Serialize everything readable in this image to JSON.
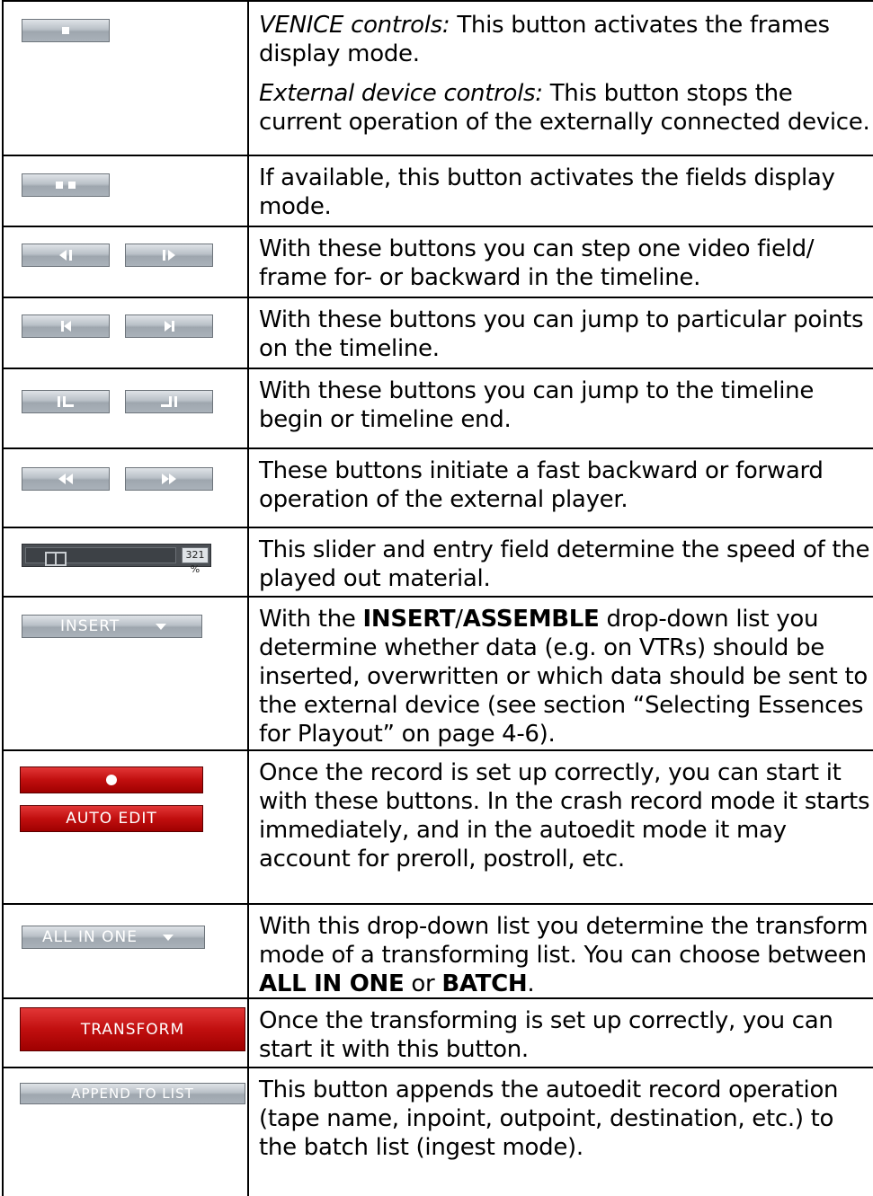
{
  "colors": {
    "grey_button": "#b9c0c7",
    "red_button": "#c10f0f",
    "rule": "#000000"
  },
  "rows": [
    {
      "icons": [
        "stop-frames-icon"
      ],
      "paragraphs": [
        {
          "italic": "VENICE controls:",
          "text": " This button activates the frames display mode."
        },
        {
          "italic": "External device controls:",
          "text": " This button stops the current operation of the externally connected device."
        }
      ]
    },
    {
      "icons": [
        "fields-icon"
      ],
      "paragraphs": [
        {
          "text": "If available, this button activates the fields display mode."
        }
      ]
    },
    {
      "icons": [
        "step-back-icon",
        "step-forward-icon"
      ],
      "paragraphs": [
        {
          "text": "With these buttons you can step one video field/ frame for- or backward in the timeline."
        }
      ]
    },
    {
      "icons": [
        "jump-previous-icon",
        "jump-next-icon"
      ],
      "paragraphs": [
        {
          "text": "With these buttons you can jump to particular points on the timeline."
        }
      ]
    },
    {
      "icons": [
        "timeline-begin-icon",
        "timeline-end-icon"
      ],
      "paragraphs": [
        {
          "text": "With these buttons you can jump to the timeline begin or timeline end."
        }
      ]
    },
    {
      "icons": [
        "fast-rewind-icon",
        "fast-forward-icon"
      ],
      "paragraphs": [
        {
          "text": "These buttons initiate a fast backward or forward operation of the external player."
        }
      ]
    },
    {
      "slider": {
        "value_label": "321 %",
        "level": 0.15
      },
      "paragraphs": [
        {
          "text": "This slider and entry field determine the speed of the played out material."
        }
      ]
    },
    {
      "dropdown": "INSERT",
      "paragraphs": [
        {
          "pre": "With the ",
          "bold1": "INSERT",
          "mid": "/",
          "bold2": "ASSEMBLE",
          "post": " drop-down list you determine whether data (e.g. on VTRs) should be inserted, overwritten or which data should be sent to the external device (see section “Selecting Essences for Playout” on page 4-6)."
        }
      ]
    },
    {
      "red_buttons": [
        "",
        "AUTO EDIT"
      ],
      "paragraphs": [
        {
          "text": "Once the record is set up correctly, you can start it with these buttons. In the crash record mode it starts immediately, and in the autoedit mode it may account for preroll, postroll, etc."
        }
      ]
    },
    {
      "dropdown": "ALL IN ONE",
      "paragraphs": [
        {
          "pre": "With this drop-down list you determine the transform mode of a transforming list. You can choose between ",
          "bold1": "ALL IN ONE",
          "mid": " or ",
          "bold2": "BATCH",
          "post": "."
        }
      ]
    },
    {
      "red_buttons": [
        "TRANSFORM"
      ],
      "paragraphs": [
        {
          "text": "Once the transforming is set up correctly, you can start it with this button."
        }
      ]
    },
    {
      "button": "APPEND TO LIST",
      "paragraphs": [
        {
          "text": "This button appends the autoedit record operation (tape name, inpoint, outpoint, destination, etc.) to the batch list (ingest mode)."
        }
      ]
    }
  ]
}
